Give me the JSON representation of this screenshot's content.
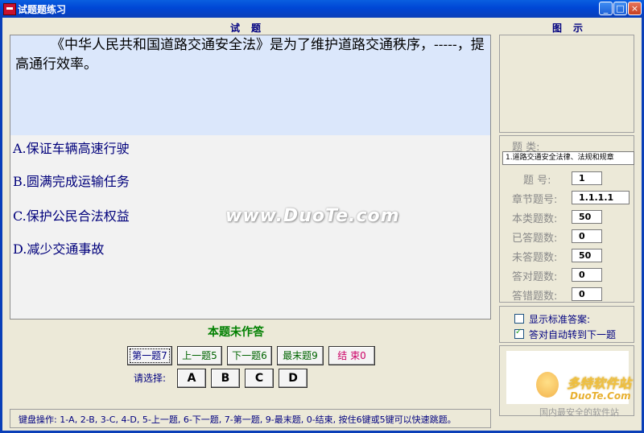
{
  "window": {
    "title": "试题题练习",
    "buttons": {
      "minimize": "_",
      "maximize": "□",
      "close": "×"
    }
  },
  "question": {
    "section_label": "试题",
    "text": "《中华人民共和国道路交通安全法》是为了维护道路交通秩序，-----，提高通行效率。",
    "options": [
      {
        "label": "A.保证车辆高速行驶"
      },
      {
        "label": "B.圆满完成运输任务"
      },
      {
        "label": "C.保护公民合法权益"
      },
      {
        "label": "D.减少交通事故"
      }
    ]
  },
  "watermark": "www.DuoTe.com",
  "status": "本题未作答",
  "nav": {
    "first": "第一题7",
    "prev": "上一题5",
    "next": "下一题6",
    "last": "最末题9",
    "end": "结 束0"
  },
  "choose": {
    "label": "请选择:",
    "choices": [
      "A",
      "B",
      "C",
      "D"
    ]
  },
  "footer": "键盘操作: 1-A, 2-B, 3-C, 4-D, 5-上一题, 6-下一题, 7-第一题, 9-最末题, 0-结束, 按住6键或5键可以快速跳题。",
  "diagram": {
    "label": "图示"
  },
  "info": {
    "category_label": "题 类:",
    "category_value": "1.道路交通安全法律、法规和规章",
    "rows": [
      {
        "label": "题    号:",
        "value": "1"
      },
      {
        "label": "章节题号:",
        "value": "1.1.1.1"
      },
      {
        "label": "本类题数:",
        "value": "50"
      },
      {
        "label": "已答题数:",
        "value": "0"
      },
      {
        "label": "未答题数:",
        "value": "50"
      },
      {
        "label": "答对题数:",
        "value": "0"
      },
      {
        "label": "答错题数:",
        "value": "0"
      }
    ]
  },
  "settings": {
    "show_answer": {
      "label": "显示标准答案:",
      "checked": false
    },
    "auto_next": {
      "label": "答对自动转到下一题",
      "checked": true
    }
  },
  "logo": {
    "brand": "多特软件站",
    "site": "DuoTe.Com",
    "slogan": "国内最安全的软件站"
  }
}
